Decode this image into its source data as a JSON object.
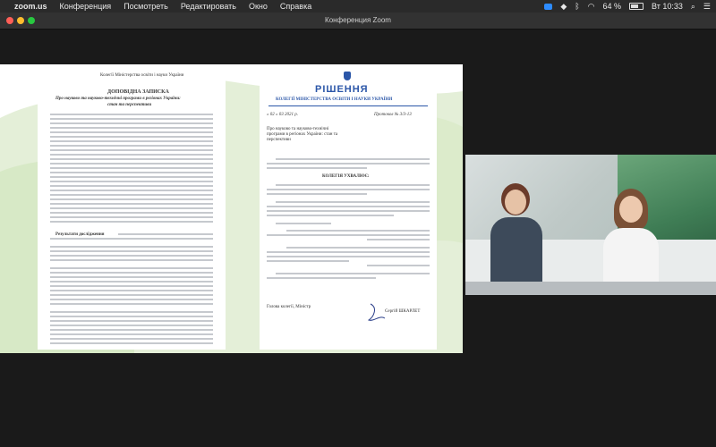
{
  "menubar": {
    "app": "zoom.us",
    "items": [
      "Конференция",
      "Посмотреть",
      "Редактировать",
      "Окно",
      "Справка"
    ],
    "battery": "64 %",
    "clock": "Вт 10:33"
  },
  "window": {
    "title": "Конференция Zoom"
  },
  "doc_left": {
    "header": "Колегії Міністерства освіти і науки України",
    "title": "ДОПОВІДНА ЗАПИСКА",
    "subtitle": "Про науково та науково-технічні програми в регіонах України:",
    "subtitle2": "стан та перспективи",
    "results": "Результати дослідження"
  },
  "doc_right": {
    "title": "РІШЕННЯ",
    "org": "КОЛЕГІЇ МІНІСТЕРСТВА ОСВІТИ І НАУКИ УКРАЇНИ",
    "date": "« 02 » 03 2021 р.",
    "protocol": "Протокол № 3/3-13",
    "subject": "Про науково та науково-технічні програми в регіонах України: стан та перспективи",
    "decided": "КОЛЕГІЯ УХВАЛЮЄ:",
    "signer_role": "Голова колегії, Міністр",
    "signer_name": "Сергій ШКАРЛЕТ"
  },
  "colors": {
    "accent": "#2b56a8",
    "map_green": "#c9e3b2"
  }
}
